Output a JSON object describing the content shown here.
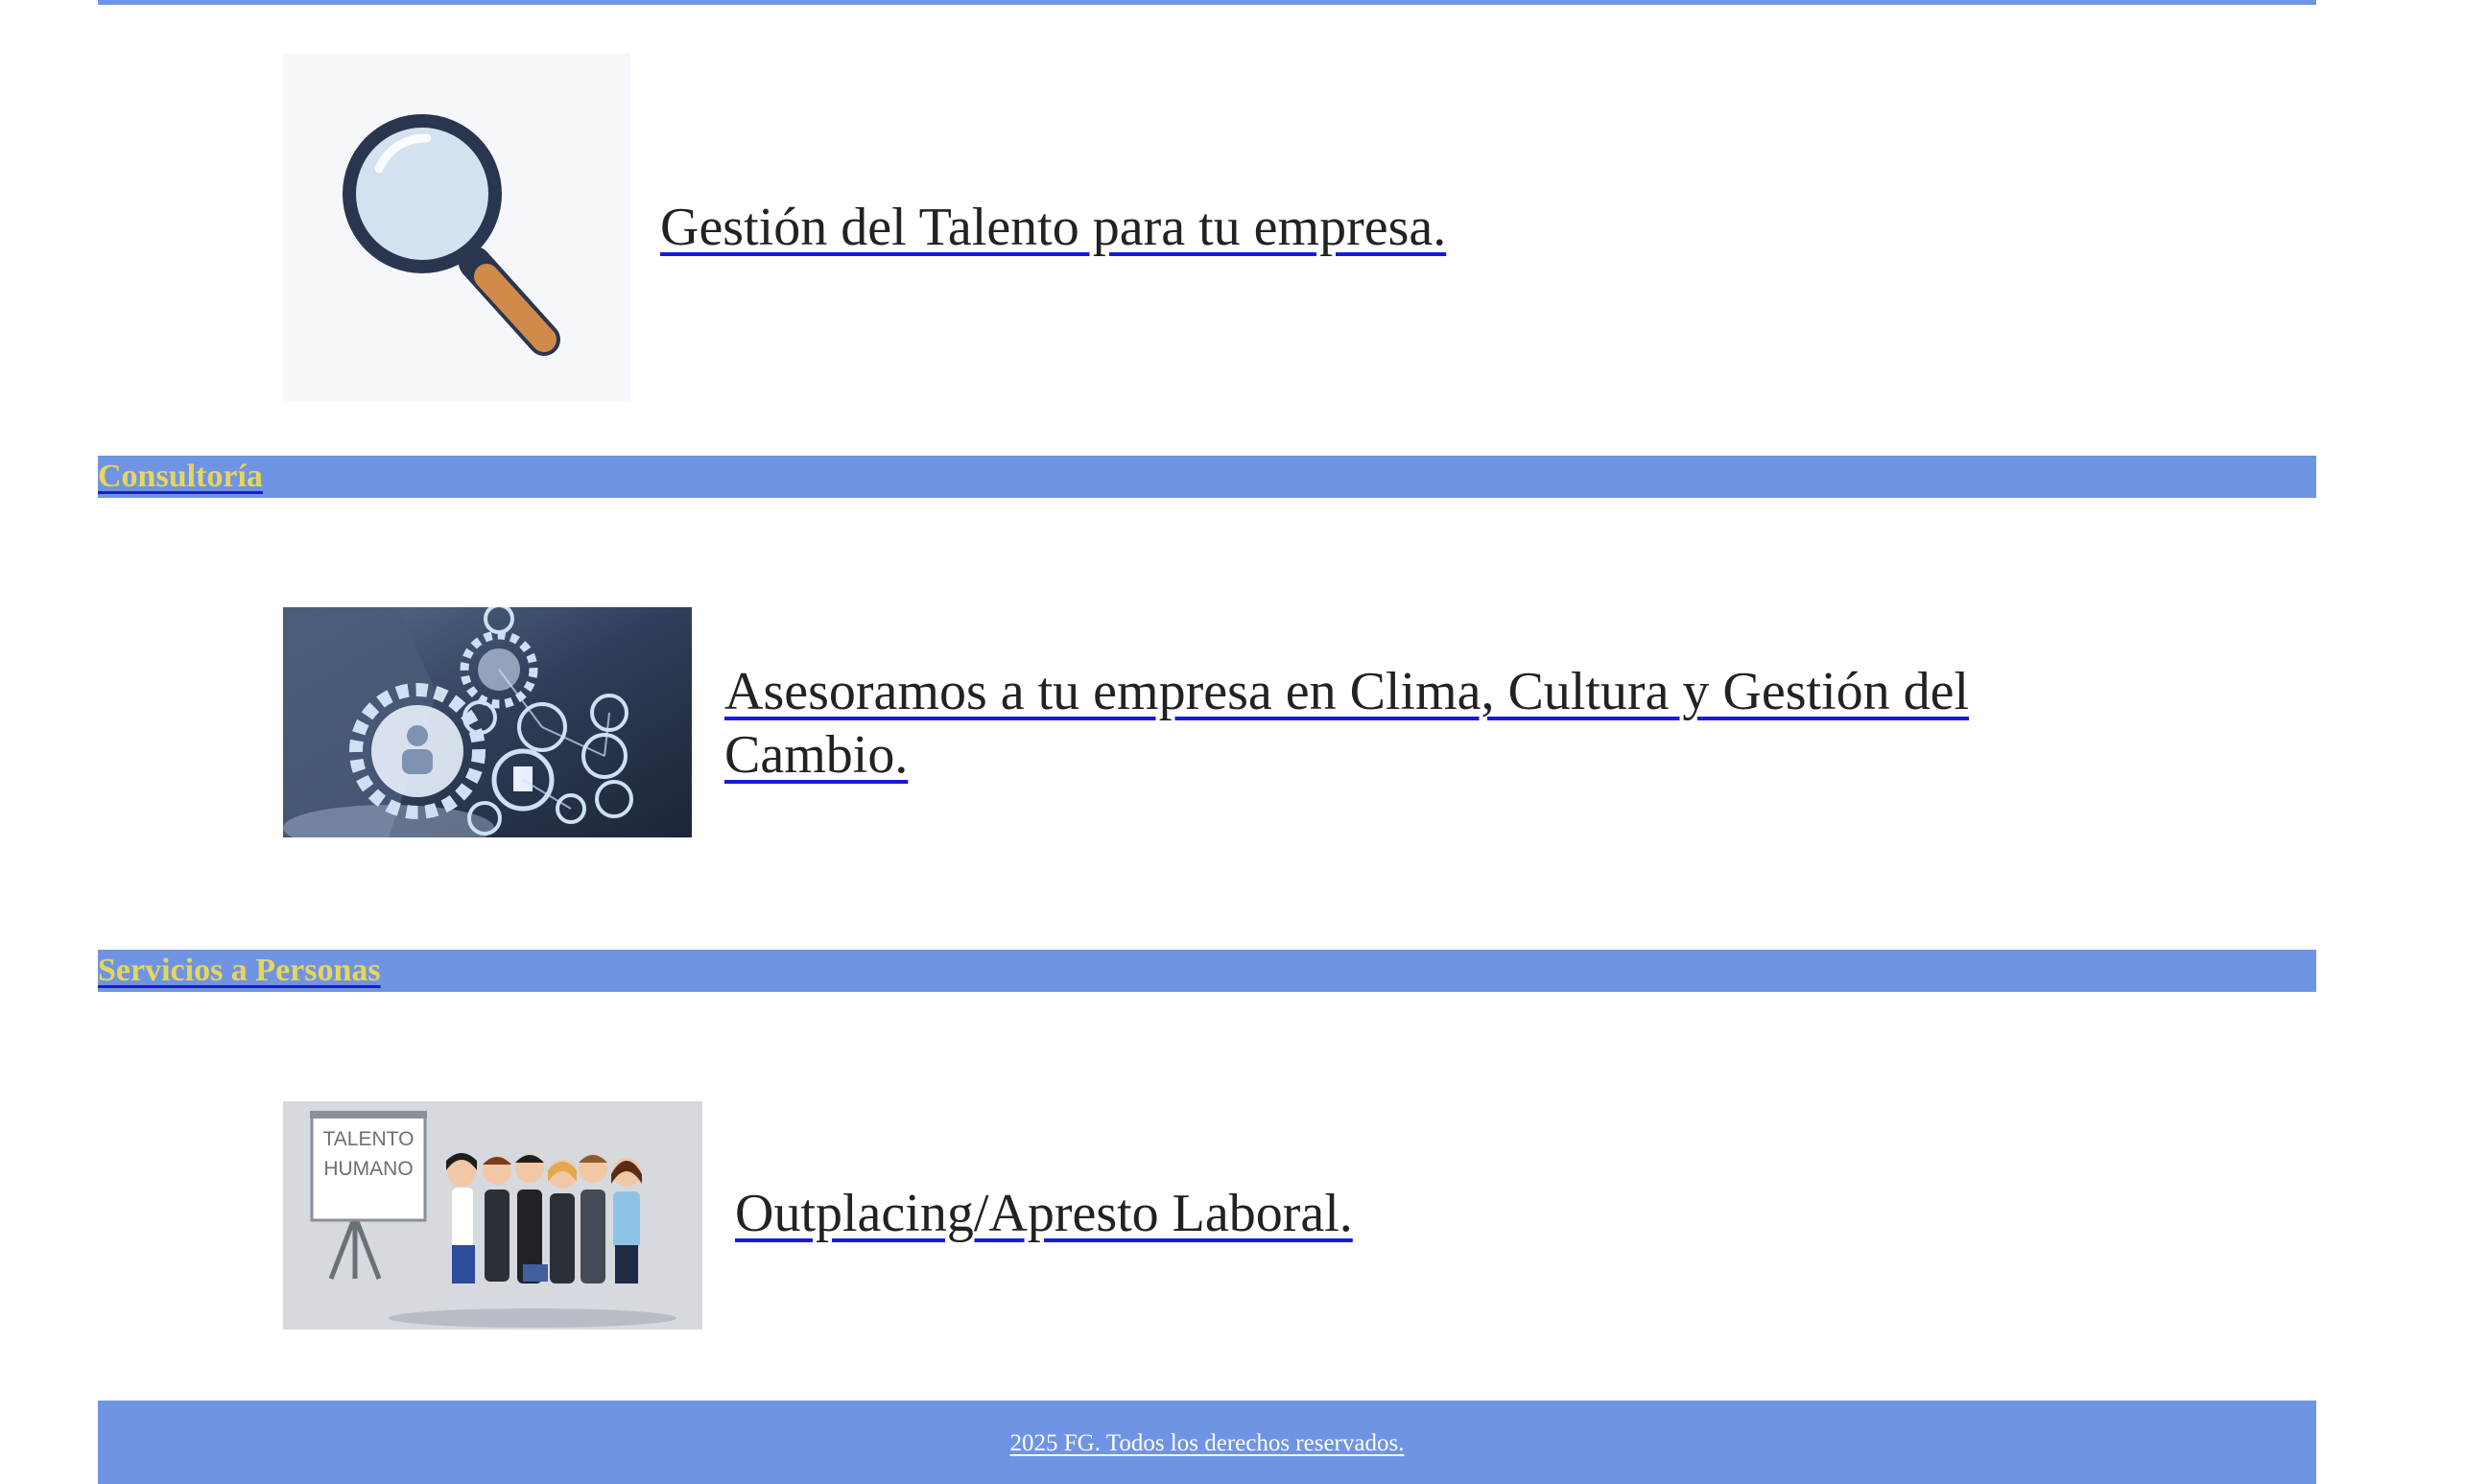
{
  "colors": {
    "bar": "#7094e4",
    "section_label": "#e7d65a",
    "link_underline": "#1a1ad8",
    "caption_text": "#222222",
    "footer_text": "#ffffff"
  },
  "talent": {
    "caption": "Gestión del Talento para tu empresa.",
    "icon": "magnifying-glass-icon"
  },
  "consultoria": {
    "section_label": "Consultoría",
    "caption": "Asesoramos a tu empresa en Clima, Cultura y Gestión del Cambio.",
    "icon": "business-network-gears-image"
  },
  "servicios": {
    "section_label": "Servicios a Personas",
    "caption": "Outplacing/Apresto Laboral.",
    "board_line_1": "TALENTO",
    "board_line_2": "HUMANO",
    "icon": "team-presentation-image"
  },
  "footer": {
    "text": "2025 FG. Todos los derechos reservados."
  }
}
